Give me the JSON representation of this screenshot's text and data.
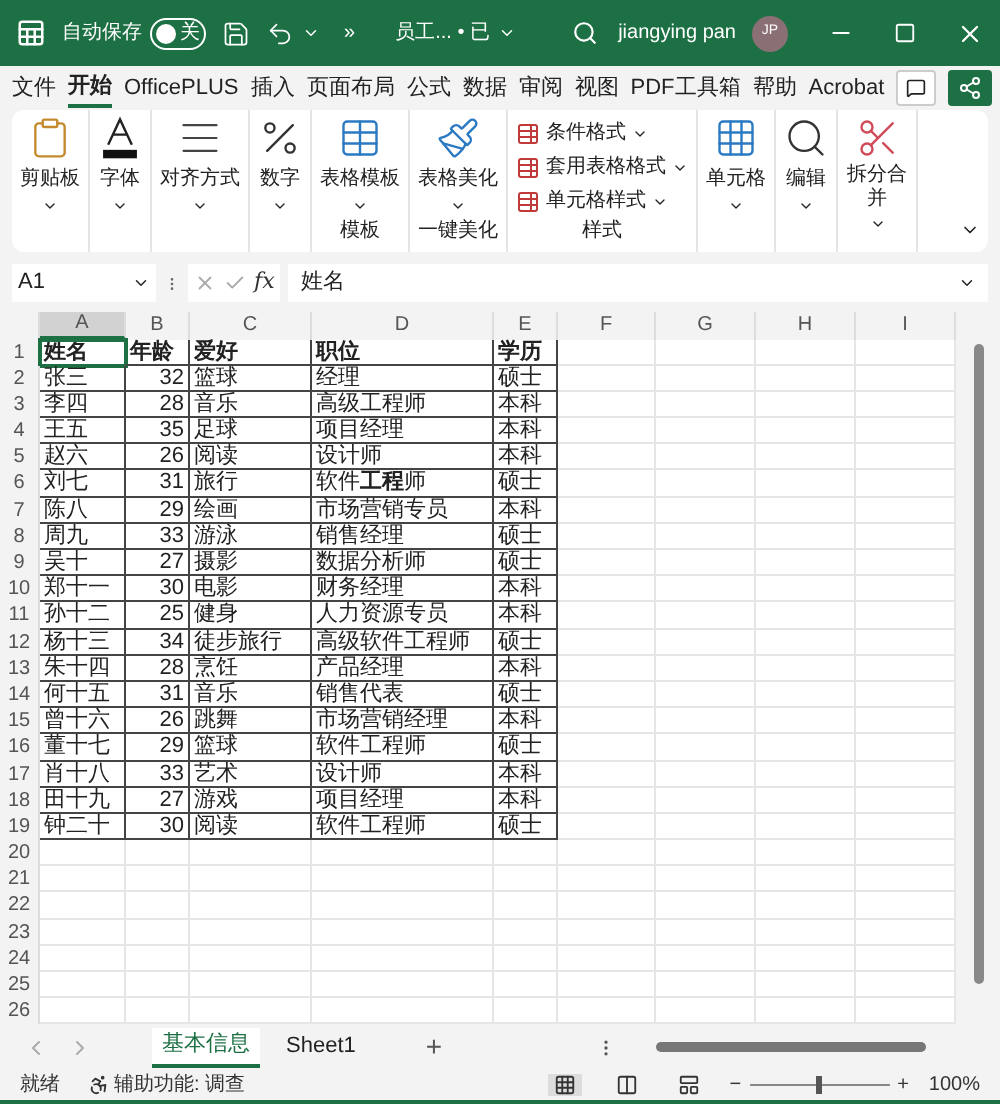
{
  "title_bar": {
    "autosave_label": "自动保存",
    "autosave": {
      "on": false,
      "label": "关"
    },
    "more": "»",
    "filename": "员工...",
    "doc_state": "• 已",
    "user": "jiangying pan",
    "avatar": "JP"
  },
  "menu_tabs": [
    {
      "label": "文件",
      "selected": false
    },
    {
      "label": "开始",
      "selected": true
    },
    {
      "label": "OfficePLUS",
      "selected": false
    },
    {
      "label": "插入",
      "selected": false
    },
    {
      "label": "页面布局",
      "selected": false
    },
    {
      "label": "公式",
      "selected": false
    },
    {
      "label": "数据",
      "selected": false
    },
    {
      "label": "审阅",
      "selected": false
    },
    {
      "label": "视图",
      "selected": false
    },
    {
      "label": "PDF工具箱",
      "selected": false
    },
    {
      "label": "帮助",
      "selected": false
    },
    {
      "label": "Acrobat",
      "selected": false
    }
  ],
  "ribbon": {
    "groups": [
      {
        "kind": "big",
        "label": "剪贴板"
      },
      {
        "kind": "big",
        "label": "字体"
      },
      {
        "kind": "big",
        "label": "对齐方式"
      },
      {
        "kind": "big",
        "label": "数字"
      },
      {
        "kind": "big",
        "label": "表格模板",
        "group_label": "模板"
      },
      {
        "kind": "big",
        "label": "表格美化",
        "group_label": "一键美化"
      },
      {
        "kind": "stack",
        "items": [
          "条件格式",
          "套用表格格式",
          "单元格样式"
        ],
        "group_label": "样式"
      },
      {
        "kind": "big",
        "label": "单元格"
      },
      {
        "kind": "big",
        "label": "编辑"
      },
      {
        "kind": "big",
        "label": "拆分合并"
      }
    ]
  },
  "formula_bar": {
    "name_box": "A1",
    "fx": "fx",
    "value": "姓名"
  },
  "columns": [
    {
      "label": "A",
      "selected": true
    },
    {
      "label": "B",
      "selected": false
    },
    {
      "label": "C",
      "selected": false
    },
    {
      "label": "D",
      "selected": false
    },
    {
      "label": "E",
      "selected": false
    },
    {
      "label": "F",
      "selected": false
    },
    {
      "label": "G",
      "selected": false
    },
    {
      "label": "H",
      "selected": false
    },
    {
      "label": "I",
      "selected": false
    }
  ],
  "rows": [
    {
      "number": "1",
      "header": true,
      "cells": [
        "姓名",
        "年龄",
        "爱好",
        "职位",
        "学历"
      ]
    },
    {
      "number": "2",
      "cells": [
        "张三",
        "32",
        "篮球",
        "经理",
        "硕士"
      ]
    },
    {
      "number": "3",
      "cells": [
        "李四",
        "28",
        "音乐",
        "高级工程师",
        "本科"
      ]
    },
    {
      "number": "4",
      "cells": [
        "王五",
        "35",
        "足球",
        "项目经理",
        "本科"
      ]
    },
    {
      "number": "5",
      "cells": [
        "赵六",
        "26",
        "阅读",
        "设计师",
        "本科"
      ]
    },
    {
      "number": "6",
      "cells": [
        "刘七",
        "31",
        "旅行",
        "软件**工程**师",
        "硕士"
      ]
    },
    {
      "number": "7",
      "cells": [
        "陈八",
        "29",
        "绘画",
        "市场营销专员",
        "本科"
      ]
    },
    {
      "number": "8",
      "cells": [
        "周九",
        "33",
        "游泳",
        "销售经理",
        "硕士"
      ]
    },
    {
      "number": "9",
      "cells": [
        "吴十",
        "27",
        "摄影",
        "数据分析师",
        "硕士"
      ]
    },
    {
      "number": "10",
      "cells": [
        "郑十一",
        "30",
        "电影",
        "财务经理",
        "本科"
      ]
    },
    {
      "number": "11",
      "cells": [
        "孙十二",
        "25",
        "健身",
        "人力资源专员",
        "本科"
      ]
    },
    {
      "number": "12",
      "cells": [
        "杨十三",
        "34",
        "徒步旅行",
        "高级软件工程师",
        "硕士"
      ]
    },
    {
      "number": "13",
      "cells": [
        "朱十四",
        "28",
        "烹饪",
        "产品经理",
        "本科"
      ]
    },
    {
      "number": "14",
      "cells": [
        "何十五",
        "31",
        "音乐",
        "销售代表",
        "硕士"
      ]
    },
    {
      "number": "15",
      "cells": [
        "曾十六",
        "26",
        "跳舞",
        "市场营销经理",
        "本科"
      ]
    },
    {
      "number": "16",
      "cells": [
        "董十七",
        "29",
        "篮球",
        "软件工程师",
        "硕士"
      ]
    },
    {
      "number": "17",
      "cells": [
        "肖十八",
        "33",
        "艺术",
        "设计师",
        "本科"
      ]
    },
    {
      "number": "18",
      "cells": [
        "田十九",
        "27",
        "游戏",
        "项目经理",
        "本科"
      ]
    },
    {
      "number": "19",
      "cells": [
        "钟二十",
        "30",
        "阅读",
        "软件工程师",
        "硕士"
      ]
    },
    {
      "number": "20"
    },
    {
      "number": "21"
    },
    {
      "number": "22"
    },
    {
      "number": "23"
    },
    {
      "number": "24"
    },
    {
      "number": "25"
    },
    {
      "number": "26"
    }
  ],
  "sheet_tabs": [
    {
      "label": "基本信息",
      "selected": true
    },
    {
      "label": "Sheet1",
      "selected": false
    }
  ],
  "add_sheet": "+",
  "status_bar": {
    "ready": "就绪",
    "accessibility": "辅助功能: 调查",
    "views": [
      {
        "selected": true
      },
      {
        "selected": false
      },
      {
        "selected": false
      }
    ],
    "zoom_minus": "−",
    "zoom_plus": "+",
    "zoom": {
      "level": 0.5
    },
    "zoom_label": "100%"
  }
}
